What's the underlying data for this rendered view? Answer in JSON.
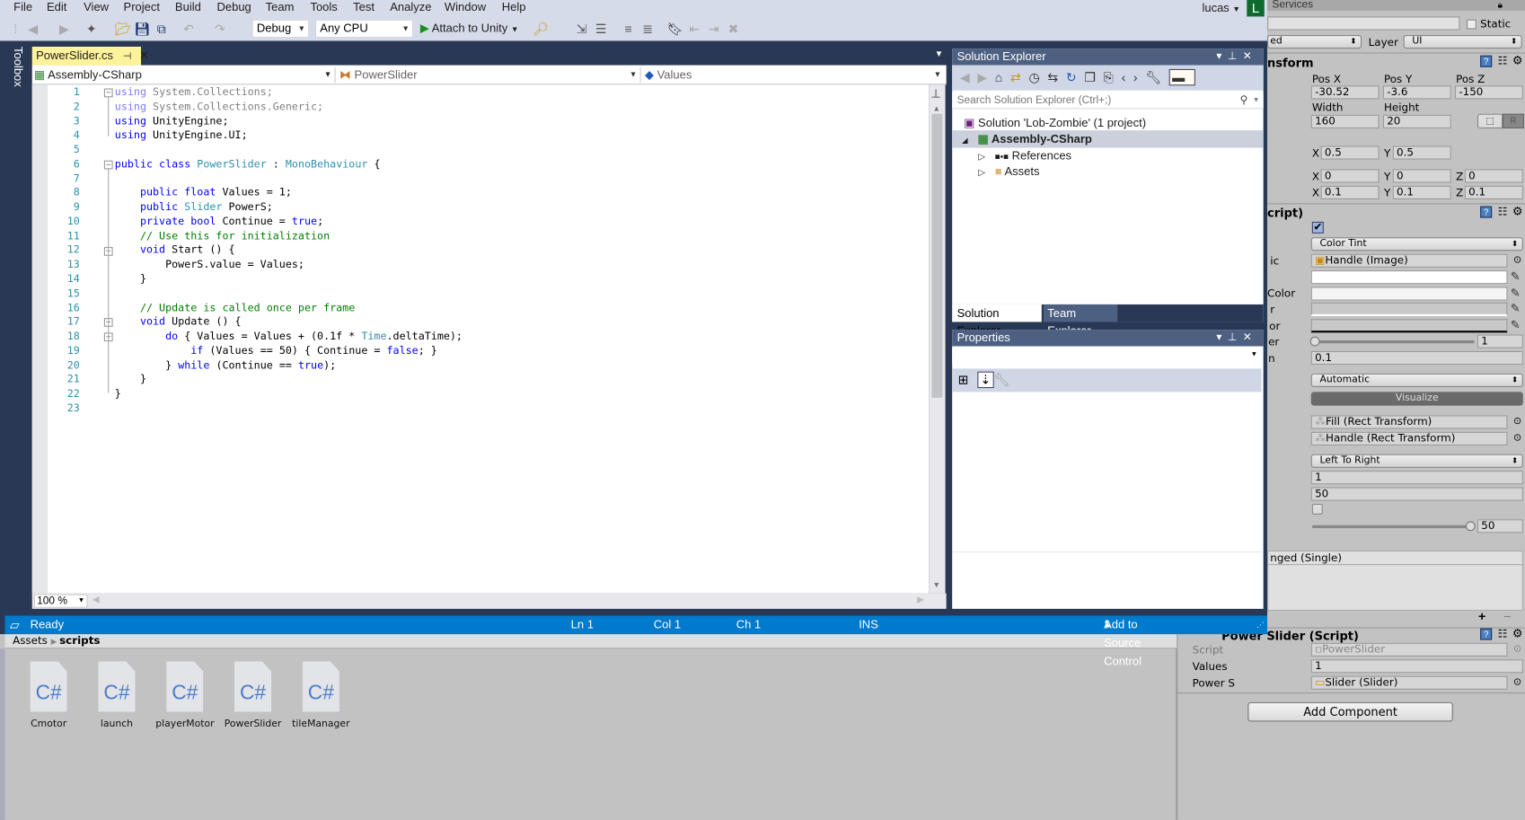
{
  "menu": [
    "File",
    "Edit",
    "View",
    "Project",
    "Build",
    "Debug",
    "Team",
    "Tools",
    "Test",
    "Analyze",
    "Window",
    "Help"
  ],
  "user": {
    "name": "lucas",
    "avatar_letter": "L",
    "avatar_color": "#0e6b2e"
  },
  "toolbar": {
    "config": "Debug",
    "platform": "Any CPU",
    "attach_label": "Attach to Unity"
  },
  "toolbox_label": "Toolbox",
  "editor": {
    "tab_title": "PowerSlider.cs",
    "nav_project": "Assembly-CSharp",
    "nav_class": "PowerSlider",
    "nav_member": "Values",
    "zoom": "100 %",
    "code_lines": [
      [
        [
          "using",
          "dimk"
        ],
        [
          " System.Collections;",
          "dim"
        ]
      ],
      [
        [
          "using",
          "dimk"
        ],
        [
          " System.Collections.Generic;",
          "dim"
        ]
      ],
      [
        [
          "using",
          "kwd"
        ],
        [
          " UnityEngine;",
          "pl"
        ]
      ],
      [
        [
          "using",
          "kwd"
        ],
        [
          " UnityEngine.UI;",
          "pl"
        ]
      ],
      [],
      [
        [
          "public class ",
          "kwd"
        ],
        [
          "PowerSlider",
          "typ"
        ],
        [
          " : ",
          "pl"
        ],
        [
          "MonoBehaviour",
          "typ"
        ],
        [
          " {",
          "pl"
        ]
      ],
      [],
      [
        [
          "    public float",
          "kwd"
        ],
        [
          " Values = 1;",
          "pl"
        ]
      ],
      [
        [
          "    public ",
          "kwd"
        ],
        [
          "Slider",
          "typ"
        ],
        [
          " PowerS;",
          "pl"
        ]
      ],
      [
        [
          "    private bool",
          "kwd"
        ],
        [
          " Continue = ",
          "pl"
        ],
        [
          "true",
          "kwd"
        ],
        [
          ";",
          "pl"
        ]
      ],
      [
        [
          "    // Use this for initialization",
          "cmt"
        ]
      ],
      [
        [
          "    void",
          "kwd"
        ],
        [
          " Start () {",
          "pl"
        ]
      ],
      [
        [
          "        PowerS.value = Values;",
          "pl"
        ]
      ],
      [
        [
          "    }",
          "pl"
        ]
      ],
      [],
      [
        [
          "    // Update is called once per frame",
          "cmt"
        ]
      ],
      [
        [
          "    void",
          "kwd"
        ],
        [
          " Update () {",
          "pl"
        ]
      ],
      [
        [
          "        do",
          "kwd"
        ],
        [
          " { Values = Values + (0.1f * ",
          "pl"
        ],
        [
          "Time",
          "typ"
        ],
        [
          ".deltaTime);",
          "pl"
        ]
      ],
      [
        [
          "            if",
          "kwd"
        ],
        [
          " (Values == 50) { Continue = ",
          "pl"
        ],
        [
          "false",
          "kwd"
        ],
        [
          "; }",
          "pl"
        ]
      ],
      [
        [
          "        } ",
          "pl"
        ],
        [
          "while",
          "kwd"
        ],
        [
          " (Continue == ",
          "pl"
        ],
        [
          "true",
          "kwd"
        ],
        [
          ");",
          "pl"
        ]
      ],
      [
        [
          "    }",
          "pl"
        ]
      ],
      [
        [
          "}",
          "pl"
        ]
      ],
      []
    ]
  },
  "solution_explorer": {
    "title": "Solution Explorer",
    "search_placeholder": "Search Solution Explorer (Ctrl+;)",
    "solution": "Solution 'Lob-Zombie' (1 project)",
    "project": "Assembly-CSharp",
    "items": [
      "References",
      "Assets"
    ],
    "tabs": [
      "Solution Explorer",
      "Team Explorer"
    ]
  },
  "properties": {
    "title": "Properties"
  },
  "status": {
    "state": "Ready",
    "ln": "Ln 1",
    "col": "Col 1",
    "ch": "Ch 1",
    "mode": "INS",
    "source_control": "Add to Source Control"
  },
  "unity": {
    "services_tab": "Services",
    "static_label": "Static",
    "tag_partial": "ed",
    "layer_label": "Layer",
    "layer_value": "UI",
    "transform_header": "nsform",
    "pos_labels": [
      "Pos X",
      "Pos Y",
      "Pos Z"
    ],
    "pos_values": [
      "-30.52",
      "-3.6",
      "-150"
    ],
    "size_labels": [
      "Width",
      "Height"
    ],
    "size_values": [
      "160",
      "20"
    ],
    "raw_button": "R",
    "pivot": {
      "x": "0.5",
      "y": "0.5"
    },
    "rotation": {
      "x": "0",
      "y": "0",
      "z": "0"
    },
    "scale": {
      "x": "0.1",
      "y": "0.1",
      "z": "0.1"
    },
    "axis": [
      "X",
      "Y",
      "Z"
    ],
    "slider_header": "cript)",
    "transition": "Color Tint",
    "target_label": "ic",
    "target_graphic": "Handle (Image)",
    "color_labels": [
      "Color",
      "r",
      "or"
    ],
    "multiplier_label": "er",
    "multiplier": "1",
    "fade_label": "n",
    "fade": "0.1",
    "navigation": "Automatic",
    "visualize": "Visualize",
    "fill_rect": "Fill (Rect Transform)",
    "handle_rect": "Handle (Rect Transform)",
    "direction": "Left To Right",
    "min_value": "1",
    "max_value": "50",
    "value": "50",
    "value_fraction": 1.0,
    "multiplier_fraction": 0.0,
    "event_label": "nged (Single)",
    "event_add": "+",
    "event_remove": "−",
    "script_component": "Power Slider (Script)",
    "script_label": "Script",
    "script_value": "PowerSlider",
    "values_label": "Values",
    "values_value": "1",
    "powers_label": "Power S",
    "powers_value": "Slider (Slider)",
    "add_component": "Add Component"
  },
  "project_browser": {
    "breadcrumb": [
      "Assets",
      "scripts"
    ],
    "assets": [
      "Cmotor",
      "launch",
      "playerMotor",
      "PowerSlider",
      "tileManager"
    ],
    "asset_glyph": "C#"
  }
}
